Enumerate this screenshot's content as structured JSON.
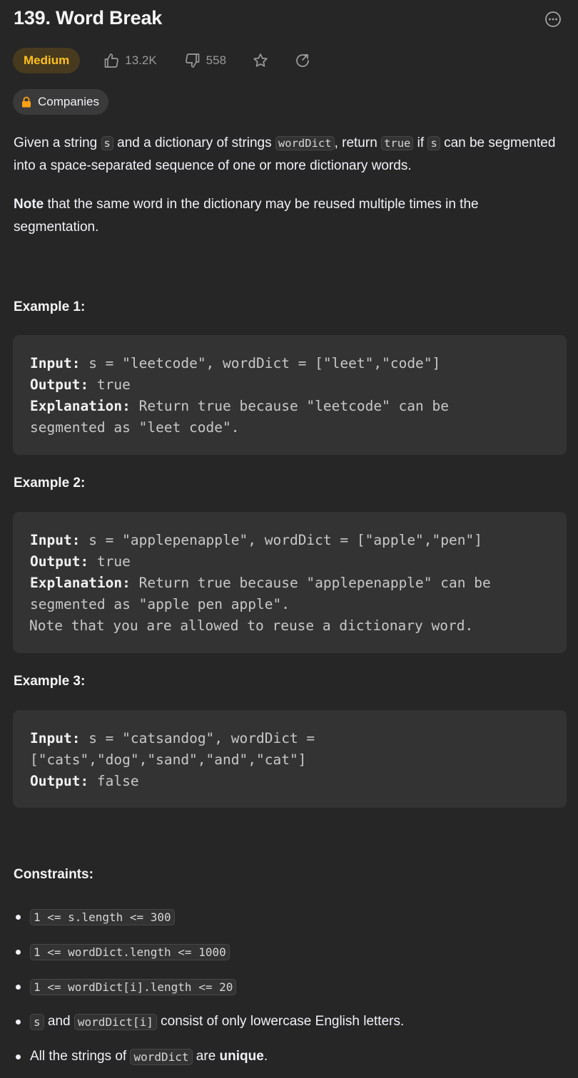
{
  "problem": {
    "title": "139. Word Break",
    "difficulty": "Medium",
    "likes": "13.2K",
    "dislikes": "558",
    "companies_label": "Companies"
  },
  "description": {
    "p1": {
      "t1": "Given a string ",
      "c1": "s",
      "t2": " and a dictionary of strings ",
      "c2": "wordDict",
      "t3": ", return ",
      "c3": "true",
      "t4": " if ",
      "c4": "s",
      "t5": " can be segmented into a space-separated sequence of one or more dictionary words."
    },
    "p2": {
      "bold": "Note",
      "rest": " that the same word in the dictionary may be reused multiple times in the segmentation."
    }
  },
  "examples": [
    {
      "title": "Example 1:",
      "input_label": "Input:",
      "input": " s = \"leetcode\", wordDict = [\"leet\",\"code\"]",
      "output_label": "Output:",
      "output": " true",
      "explanation_label": "Explanation:",
      "explanation_l1": " Return true because \"leetcode\" can be",
      "explanation_l2": "segmented as \"leet code\"."
    },
    {
      "title": "Example 2:",
      "input_label": "Input:",
      "input": " s = \"applepenapple\", wordDict = [\"apple\",\"pen\"]",
      "output_label": "Output:",
      "output": " true",
      "explanation_label": "Explanation:",
      "explanation_l1": " Return true because \"applepenapple\" can be",
      "explanation_l2": "segmented as \"apple pen apple\".",
      "explanation_l3": "Note that you are allowed to reuse a dictionary word."
    },
    {
      "title": "Example 3:",
      "input_label": "Input:",
      "input_l1": " s = \"catsandog\", wordDict =",
      "input_l2": "[\"cats\",\"dog\",\"sand\",\"and\",\"cat\"]",
      "output_label": "Output:",
      "output": " false"
    }
  ],
  "constraints": {
    "title": "Constraints:",
    "c1": "1 <= s.length <= 300",
    "c2": "1 <= wordDict.length <= 1000",
    "c3": "1 <= wordDict[i].length <= 20",
    "c4": {
      "code1": "s",
      "t1": " and ",
      "code2": "wordDict[i]",
      "t2": " consist of only lowercase English letters."
    },
    "c5": {
      "t1": "All the strings of ",
      "code1": "wordDict",
      "t2": " are ",
      "bold": "unique",
      "t3": "."
    }
  },
  "colors": {
    "background": "#262626",
    "medium_badge_text": "#ffc01e",
    "medium_badge_bg": "#473a1e",
    "lock": "#ffa116"
  },
  "icons": [
    "more-options-icon",
    "thumbs-up-icon",
    "thumbs-down-icon",
    "star-icon",
    "share-icon",
    "lock-icon"
  ]
}
